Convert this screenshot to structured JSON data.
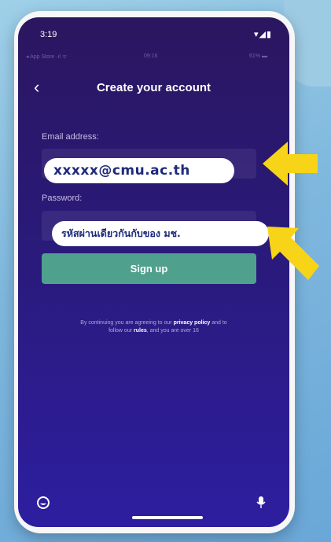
{
  "status_bar": {
    "time": "3:19",
    "icons": "▾◢▮"
  },
  "inner_status": {
    "left": "◂ App Store ·ıl ᯤ",
    "center": "09:16",
    "right": "61% ▬"
  },
  "header": {
    "back_icon": "‹",
    "title": "Create your account"
  },
  "form": {
    "email_label": "Email address:",
    "email_value": "",
    "password_label": "Password:",
    "password_value": "",
    "signup_label": "Sign up"
  },
  "terms": {
    "t1": "By continuing you are agreeing to our ",
    "t2": "privacy policy",
    "t3": " and to",
    "t4": "follow our ",
    "t5": "rules",
    "t6": ", and you are over 16"
  },
  "annotations": {
    "email_callout": "xxxxx@cmu.ac.th",
    "password_callout": "รหัสผ่านเดียวกันกับของ มช.",
    "arrow_color": "#f7d417"
  },
  "bottom_bar": {
    "left_icon": "smiley-icon",
    "right_icon": "microphone-icon"
  }
}
